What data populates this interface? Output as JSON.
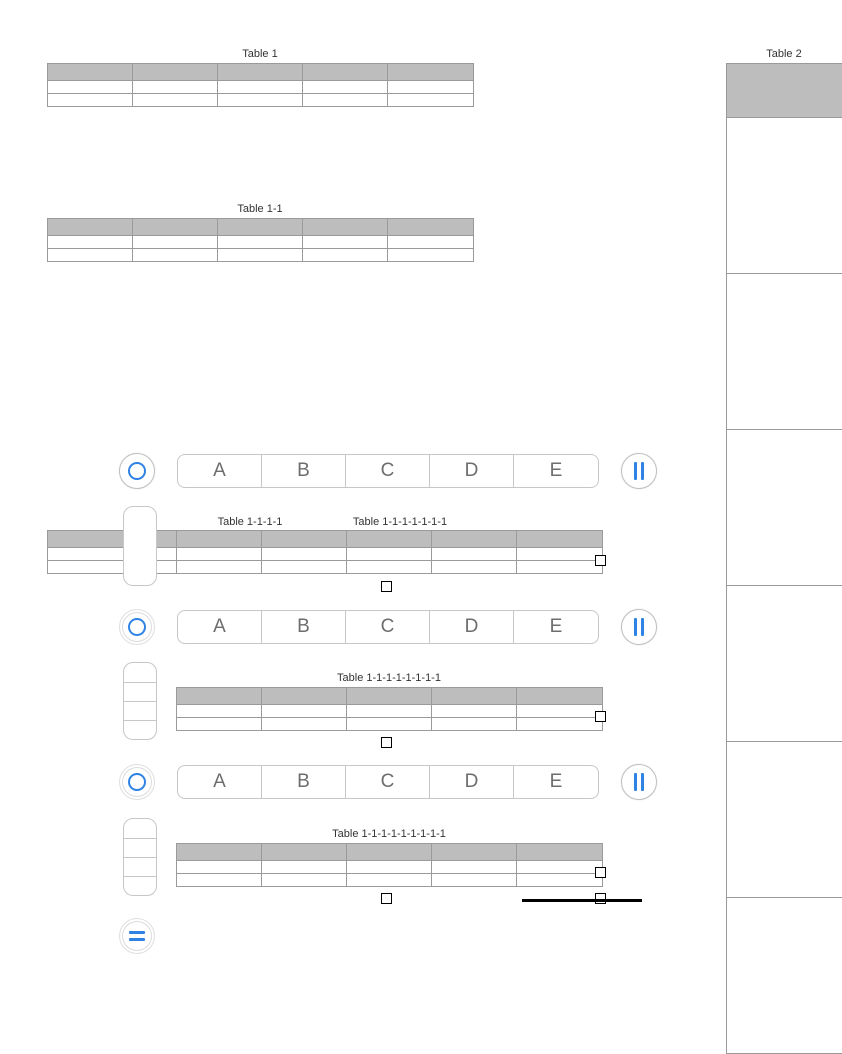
{
  "captions": {
    "t1": "Table 1",
    "t2": "Table 2",
    "t1_1": "Table 1-1",
    "t1_1_1_1": "Table 1-1-1-1",
    "t1x6": "Table 1-1-1-1-1-1-1",
    "t1x7": "Table 1-1-1-1-1-1-1-1",
    "t1x8": "Table 1-1-1-1-1-1-1-1-1"
  },
  "segments": {
    "a": "A",
    "b": "B",
    "c": "C",
    "d": "D",
    "e": "E"
  }
}
